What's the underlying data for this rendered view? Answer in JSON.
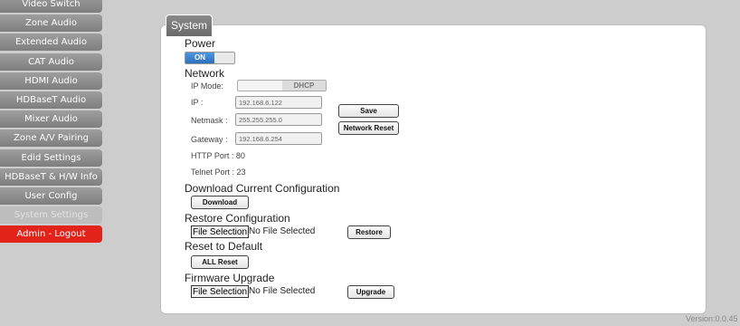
{
  "sidebar": {
    "items": [
      {
        "label": "Video Switch"
      },
      {
        "label": "Zone Audio"
      },
      {
        "label": "Extended Audio"
      },
      {
        "label": "CAT Audio"
      },
      {
        "label": "HDMI Audio"
      },
      {
        "label": "HDBaseT Audio"
      },
      {
        "label": "Mixer Audio"
      },
      {
        "label": "Zone A/V Pairing"
      },
      {
        "label": "Edid Settings"
      },
      {
        "label": "HDBaseT & H/W Info"
      },
      {
        "label": "User Config"
      },
      {
        "label": "System Settings"
      },
      {
        "label": "Admin - Logout"
      }
    ]
  },
  "panel": {
    "tab_label": "System",
    "power": {
      "heading": "Power",
      "toggle_value": "ON"
    },
    "network": {
      "heading": "Network",
      "ip_mode_label": "IP Mode:",
      "ip_mode_value": "DHCP",
      "ip_label": "IP :",
      "ip_value": "192.168.6.122",
      "netmask_label": "Netmask :",
      "netmask_value": "255.255.255.0",
      "gateway_label": "Gateway :",
      "gateway_value": "192.168.6.254",
      "http_port": "HTTP Port : 80",
      "telnet_port": "Telnet Port : 23",
      "save_label": "Save",
      "reset_label": "Network Reset"
    },
    "download": {
      "heading": "Download Current Configuration",
      "button": "Download"
    },
    "restore": {
      "heading": "Restore Configuration",
      "file_button": "File Selection",
      "file_status": "No File Selected",
      "button": "Restore"
    },
    "reset": {
      "heading": "Reset to Default",
      "button": "ALL Reset"
    },
    "firmware": {
      "heading": "Firmware Upgrade",
      "file_button": "File Selection",
      "file_status": "No File Selected",
      "button": "Upgrade"
    }
  },
  "version": "Version:0.0.45"
}
